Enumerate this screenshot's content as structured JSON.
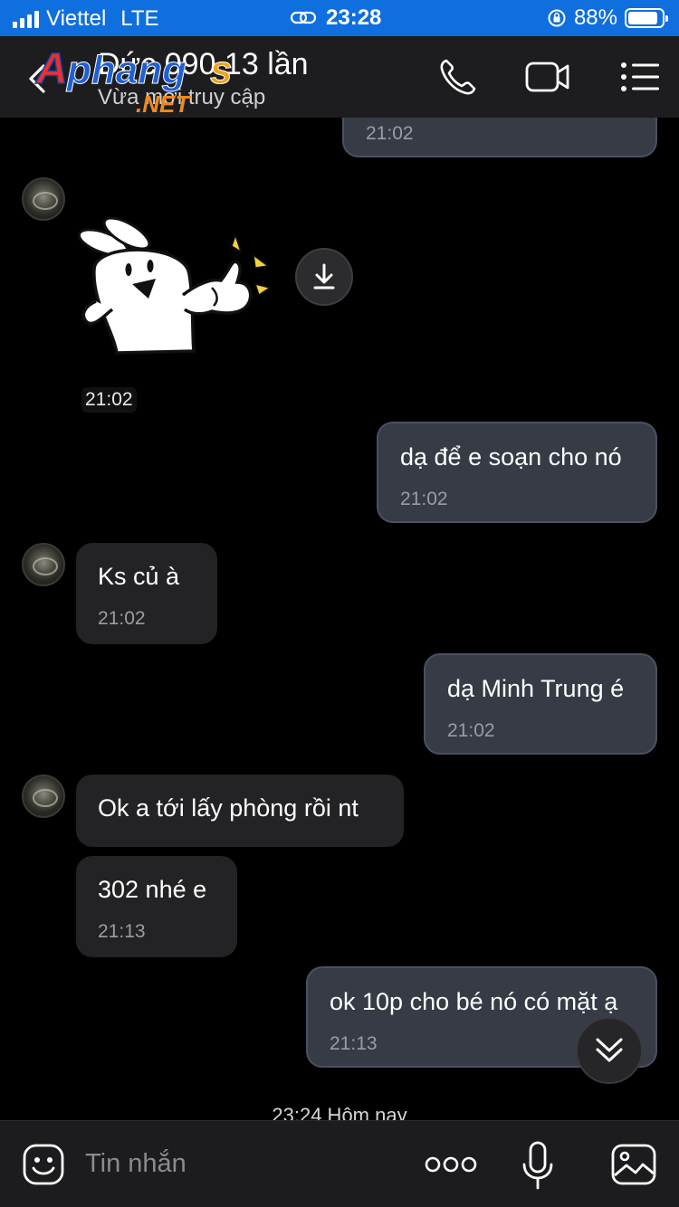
{
  "status_bar": {
    "carrier": "Viettel",
    "network": "LTE",
    "time": "23:28",
    "battery": "88%",
    "battery_level": 0.88
  },
  "header": {
    "title": "Đức 090 13 lần",
    "status": "Vừa mới truy cập",
    "watermark": "Aphangs .NET",
    "icons": [
      "back-icon",
      "phone-icon",
      "video-icon",
      "menu-icon"
    ]
  },
  "messages": {
    "m0": {
      "time": "21:02"
    },
    "sticker": {
      "time": "21:02",
      "icon": "download-icon"
    },
    "m1": {
      "text": "dạ để e soạn cho nó",
      "time": "21:02"
    },
    "m2": {
      "text": "Ks củ à",
      "time": "21:02"
    },
    "m3": {
      "text": "dạ Minh Trung é",
      "time": "21:02"
    },
    "m4": {
      "text": "Ok  a tới lấy phòng rồi nt"
    },
    "m5": {
      "text": "302 nhé e",
      "time": "21:13"
    },
    "m6": {
      "text": "ok 10p cho bé nó có mặt ạ",
      "time": "21:13"
    }
  },
  "date_separator": "23:24 Hôm nay",
  "input_bar": {
    "placeholder": "Tin nhắn",
    "icons": [
      "emoji-icon",
      "more-icon",
      "mic-icon",
      "image-icon"
    ]
  },
  "colors": {
    "status_bar": "#0f6fde",
    "header": "#1d1d1f",
    "outgoing_bubble": "#363b45",
    "incoming_bubble": "#232325",
    "background": "#000000"
  }
}
